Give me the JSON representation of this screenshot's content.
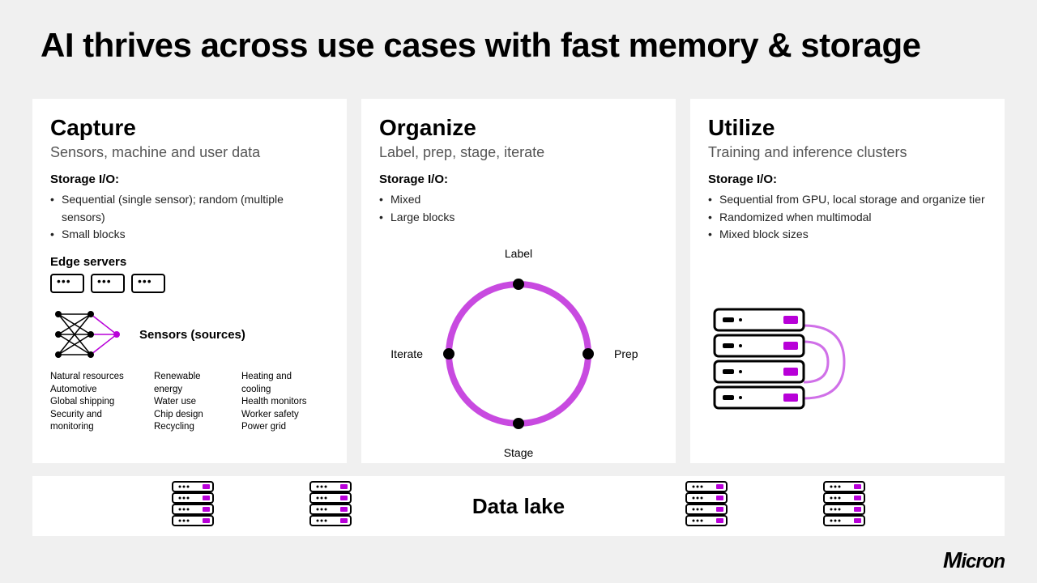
{
  "title": "AI thrives across use cases with fast memory & storage",
  "accent": "#b800d8",
  "cards": {
    "capture": {
      "heading": "Capture",
      "subtitle": "Sensors, machine and user data",
      "io_label": "Storage I/O:",
      "bullets": [
        "Sequential (single sensor); random (multiple sensors)",
        "Small blocks"
      ],
      "edge_label": "Edge servers",
      "sensors_label": "Sensors (sources)",
      "sources_col1": "Natural resources\nAutomotive\nGlobal shipping\nSecurity and monitoring",
      "sources_col2": "Renewable energy\nWater use\nChip design\nRecycling",
      "sources_col3": "Heating and cooling\nHealth monitors\nWorker safety\nPower grid"
    },
    "organize": {
      "heading": "Organize",
      "subtitle": "Label, prep, stage, iterate",
      "io_label": "Storage I/O:",
      "bullets": [
        "Mixed",
        "Large blocks"
      ],
      "cycle": {
        "top": "Label",
        "right": "Prep",
        "bottom": "Stage",
        "left": "Iterate"
      }
    },
    "utilize": {
      "heading": "Utilize",
      "subtitle": "Training and inference clusters",
      "io_label": "Storage I/O:",
      "bullets": [
        "Sequential from GPU, local storage and organize tier",
        "Randomized when multimodal",
        "Mixed block sizes"
      ]
    }
  },
  "datalake": {
    "label": "Data lake"
  },
  "brand": "Micron"
}
